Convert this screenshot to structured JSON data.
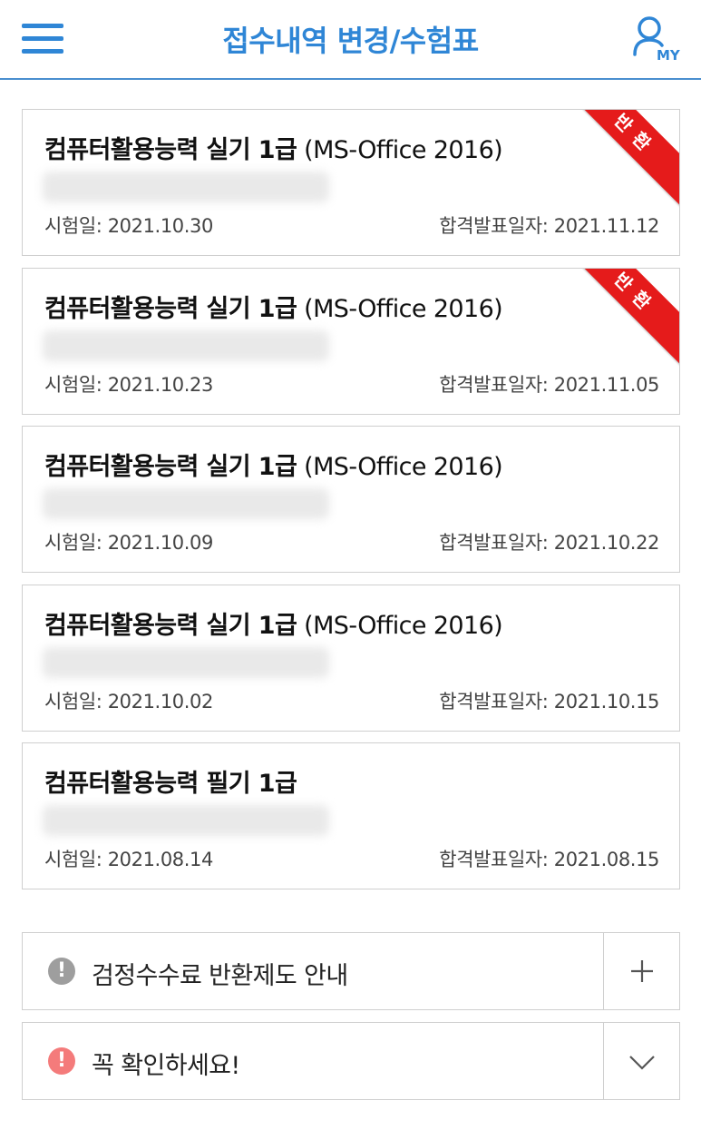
{
  "header": {
    "title": "접수내역 변경/수험표",
    "my_label": "MY"
  },
  "colors": {
    "accent": "#2f86d6",
    "ribbon": "#e51b1b",
    "info_icon": "#9e9e9e",
    "warning_icon": "#f47b7b"
  },
  "cards": [
    {
      "title_bold": "컴퓨터활용능력 실기 1급",
      "title_sub": " (MS-Office 2016)",
      "exam_date": "시험일: 2021.10.30",
      "result_date": "합격발표일자: 2021.11.12",
      "ribbon": "반환"
    },
    {
      "title_bold": "컴퓨터활용능력 실기 1급",
      "title_sub": " (MS-Office 2016)",
      "exam_date": "시험일: 2021.10.23",
      "result_date": "합격발표일자: 2021.11.05",
      "ribbon": "반환"
    },
    {
      "title_bold": "컴퓨터활용능력 실기 1급",
      "title_sub": " (MS-Office 2016)",
      "exam_date": "시험일: 2021.10.09",
      "result_date": "합격발표일자: 2021.10.22"
    },
    {
      "title_bold": "컴퓨터활용능력 실기 1급",
      "title_sub": " (MS-Office 2016)",
      "exam_date": "시험일: 2021.10.02",
      "result_date": "합격발표일자: 2021.10.15"
    },
    {
      "title_bold": "컴퓨터활용능력 필기 1급",
      "title_sub": "",
      "exam_date": "시험일: 2021.08.14",
      "result_date": "합격발표일자: 2021.08.15"
    }
  ],
  "accordions": [
    {
      "label": "검정수수료 반환제도 안내",
      "icon": "info-icon",
      "toggle": "plus-icon"
    },
    {
      "label": "꼭 확인하세요!",
      "icon": "warning-icon",
      "toggle": "chevron-down-icon"
    }
  ]
}
